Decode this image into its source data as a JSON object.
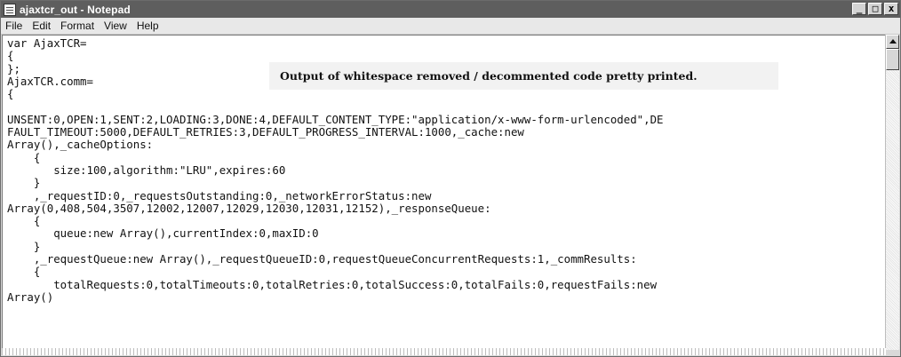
{
  "window": {
    "title": "ajaxtcr_out - Notepad",
    "controls": {
      "minimize": "_",
      "maximize": "□",
      "close": "x"
    }
  },
  "menu": {
    "items": [
      "File",
      "Edit",
      "Format",
      "View",
      "Help"
    ]
  },
  "callout": {
    "text": "Output of whitespace removed / decommented code pretty printed."
  },
  "editor": {
    "text": "var AjaxTCR=\n{\n};\nAjaxTCR.comm=\n{\n\nUNSENT:0,OPEN:1,SENT:2,LOADING:3,DONE:4,DEFAULT_CONTENT_TYPE:\"application/x-www-form-urlencoded\",DE\nFAULT_TIMEOUT:5000,DEFAULT_RETRIES:3,DEFAULT_PROGRESS_INTERVAL:1000,_cache:new\nArray(),_cacheOptions:\n    {\n       size:100,algorithm:\"LRU\",expires:60\n    }\n    ,_requestID:0,_requestsOutstanding:0,_networkErrorStatus:new\nArray(0,408,504,3507,12002,12007,12029,12030,12031,12152),_responseQueue:\n    {\n       queue:new Array(),currentIndex:0,maxID:0\n    }\n    ,_requestQueue:new Array(),_requestQueueID:0,requestQueueConcurrentRequests:1,_commResults:\n    {\n       totalRequests:0,totalTimeouts:0,totalRetries:0,totalSuccess:0,totalFails:0,requestFails:new\nArray()"
  }
}
